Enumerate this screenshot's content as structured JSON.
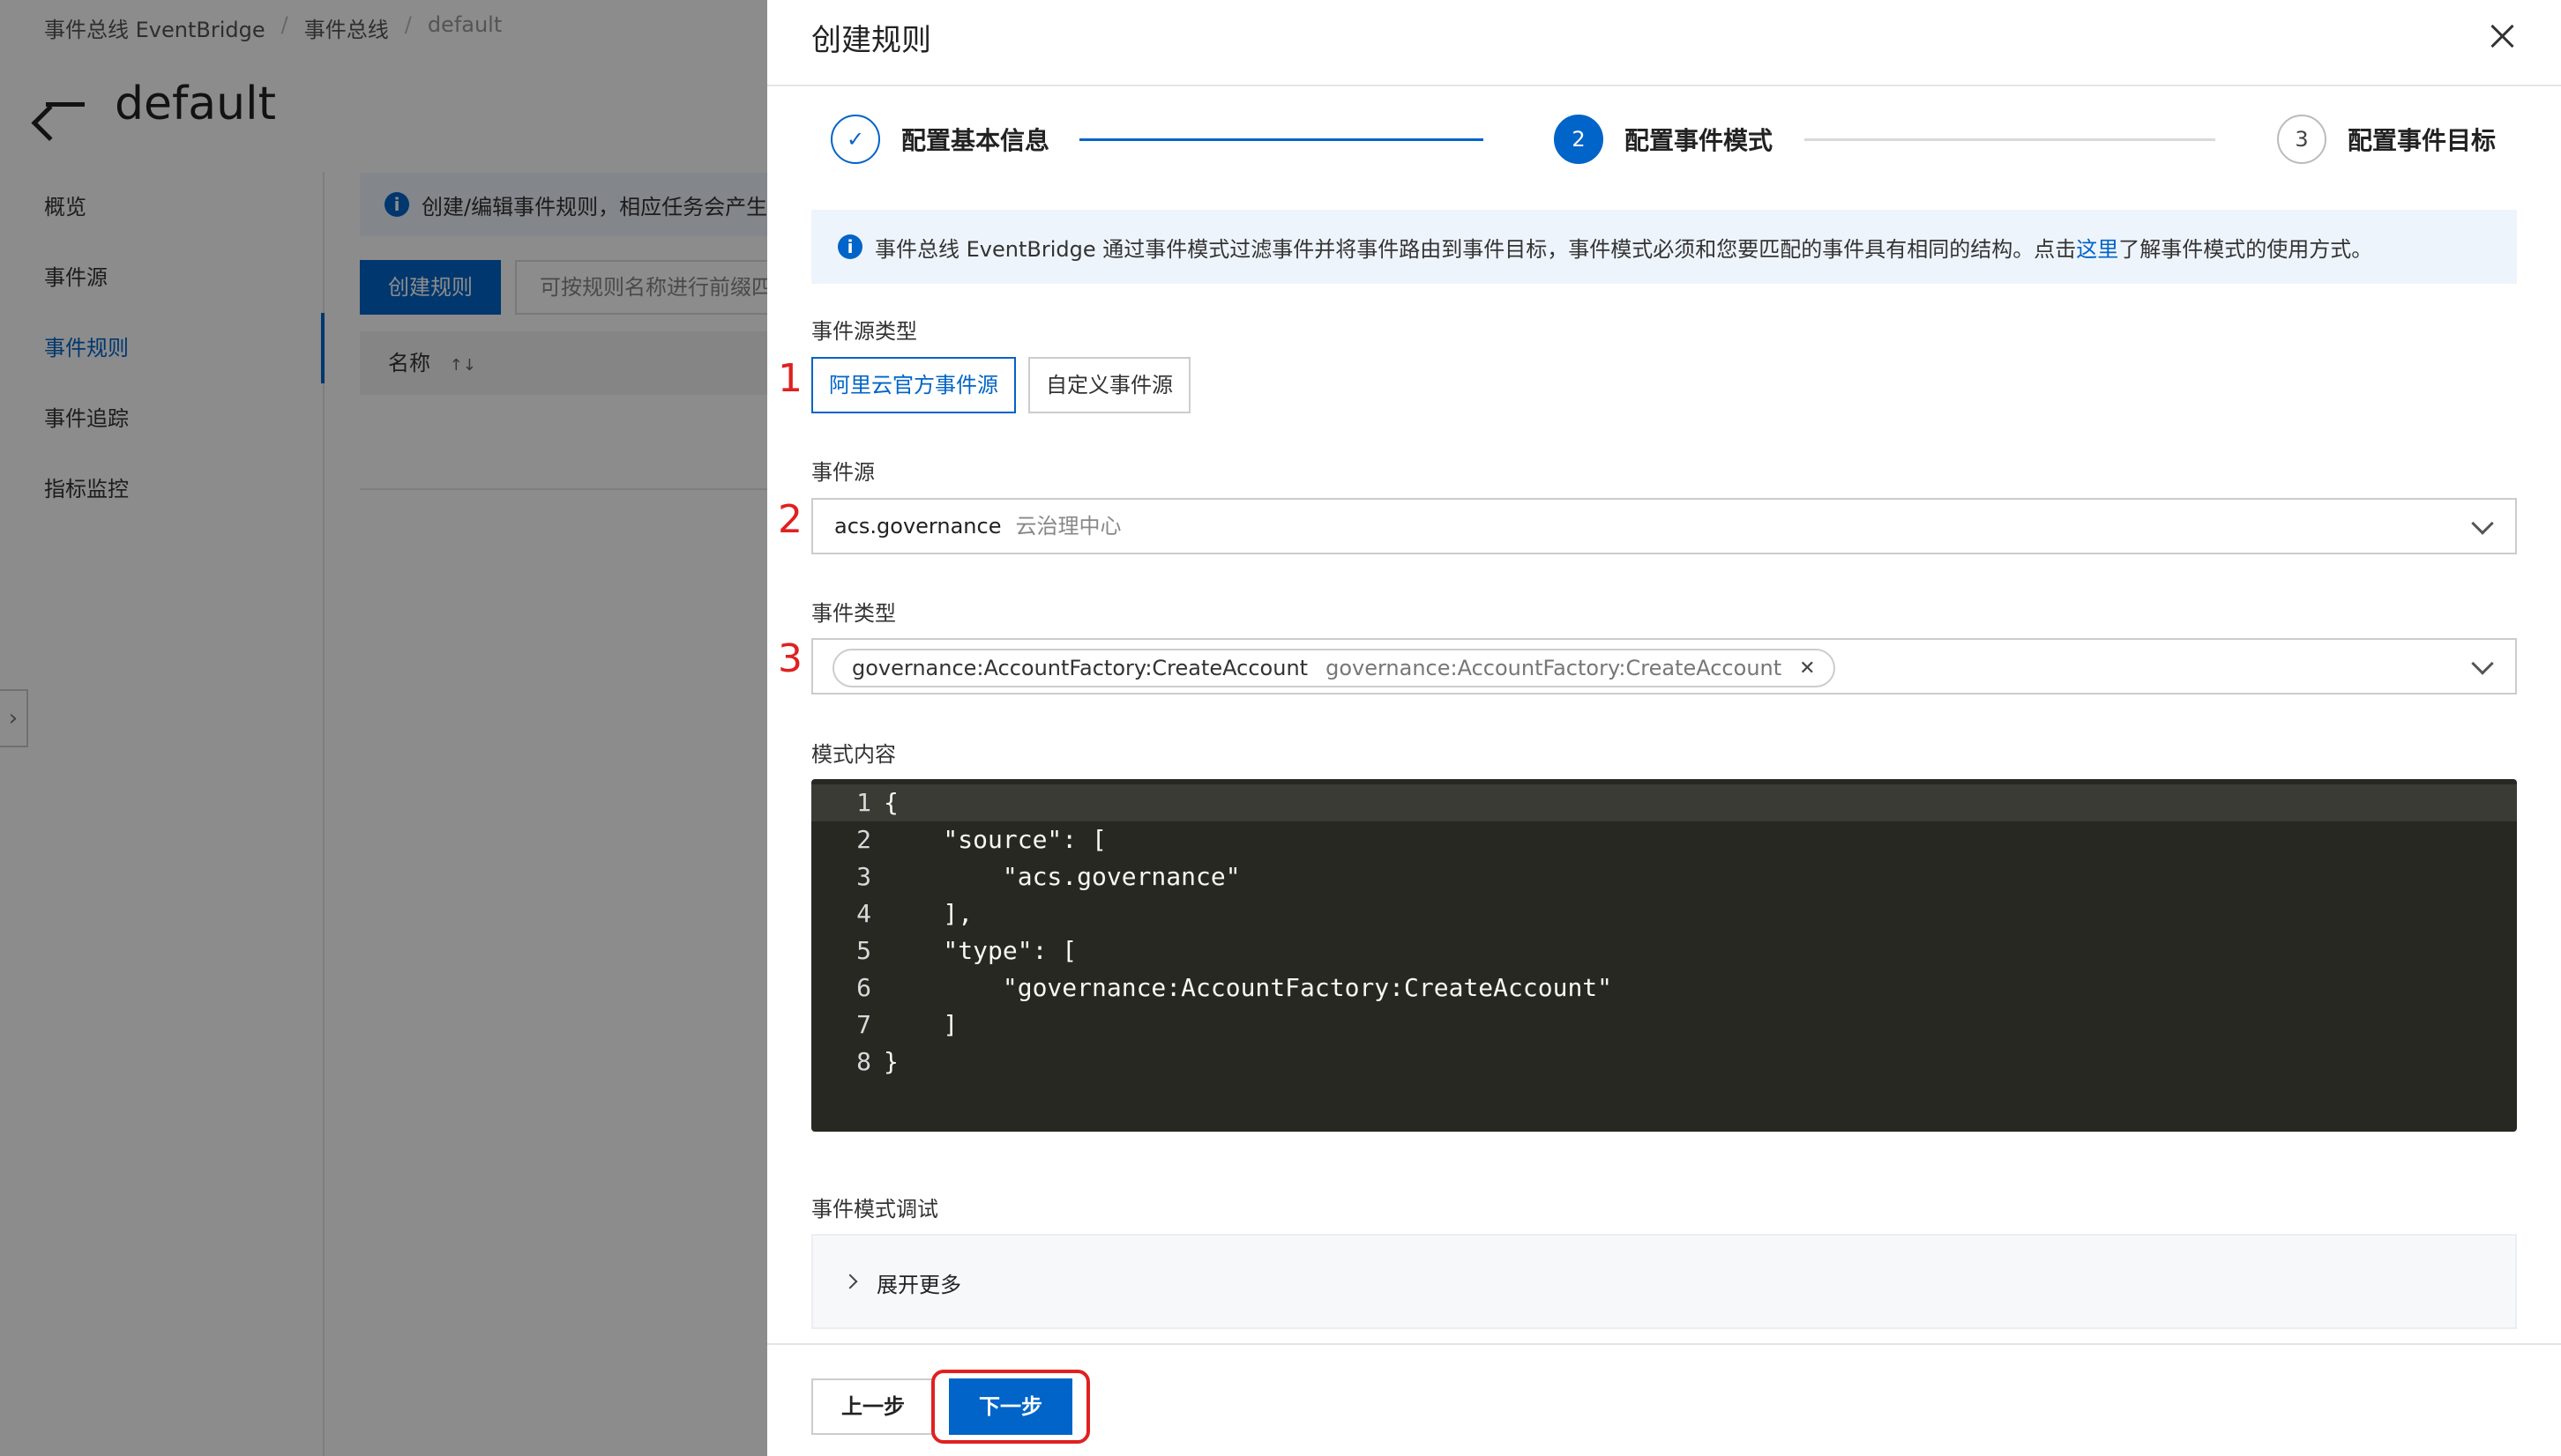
{
  "background": {
    "breadcrumb": [
      "事件总线 EventBridge",
      "事件总线",
      "default"
    ],
    "breadcrumb_separator": "/",
    "page_title": "default",
    "nav_items": [
      {
        "label": "概览",
        "active": false
      },
      {
        "label": "事件源",
        "active": false
      },
      {
        "label": "事件规则",
        "active": true
      },
      {
        "label": "事件追踪",
        "active": false
      },
      {
        "label": "指标监控",
        "active": false
      }
    ],
    "info_text": "创建/编辑事件规则，相应任务会产生",
    "create_rule_button": "创建规则",
    "search_placeholder": "可按规则名称进行前缀四",
    "table_column_name": "名称",
    "sort_glyph": "↑↓"
  },
  "drawer": {
    "title": "创建规则",
    "steps": [
      {
        "number": "✓",
        "label": "配置基本信息",
        "state": "done"
      },
      {
        "number": "2",
        "label": "配置事件模式",
        "state": "current"
      },
      {
        "number": "3",
        "label": "配置事件目标",
        "state": "pending"
      }
    ],
    "info": {
      "text_before": "事件总线 EventBridge 通过事件模式过滤事件并将事件路由到事件目标，事件模式必须和您要匹配的事件具有相同的结构。点击",
      "link": "这里",
      "text_after": "了解事件模式的使用方式。"
    },
    "source_type": {
      "label": "事件源类型",
      "options": [
        "阿里云官方事件源",
        "自定义事件源"
      ],
      "selected": "阿里云官方事件源"
    },
    "event_source": {
      "label": "事件源",
      "value": "acs.governance",
      "description": "云治理中心"
    },
    "event_type": {
      "label": "事件类型",
      "tag_value": "governance:AccountFactory:CreateAccount",
      "tag_description": "governance:AccountFactory:CreateAccount"
    },
    "pattern": {
      "label": "模式内容",
      "line_numbers": [
        "1",
        "2",
        "3",
        "4",
        "5",
        "6",
        "7",
        "8"
      ],
      "lines": [
        "{",
        "    \"source\": [",
        "        \"acs.governance\"",
        "    ],",
        "    \"type\": [",
        "        \"governance:AccountFactory:CreateAccount\"",
        "    ]",
        "}"
      ]
    },
    "debug": {
      "label": "事件模式调试",
      "expand_label": "展开更多"
    },
    "footer": {
      "prev_button": "上一步",
      "next_button": "下一步"
    },
    "annotations": [
      "1",
      "2",
      "3"
    ]
  },
  "colors": {
    "primary": "#0064c8",
    "annotation_red": "#e02020",
    "editor_bg": "#272822",
    "editor_string": "#e6db74"
  }
}
